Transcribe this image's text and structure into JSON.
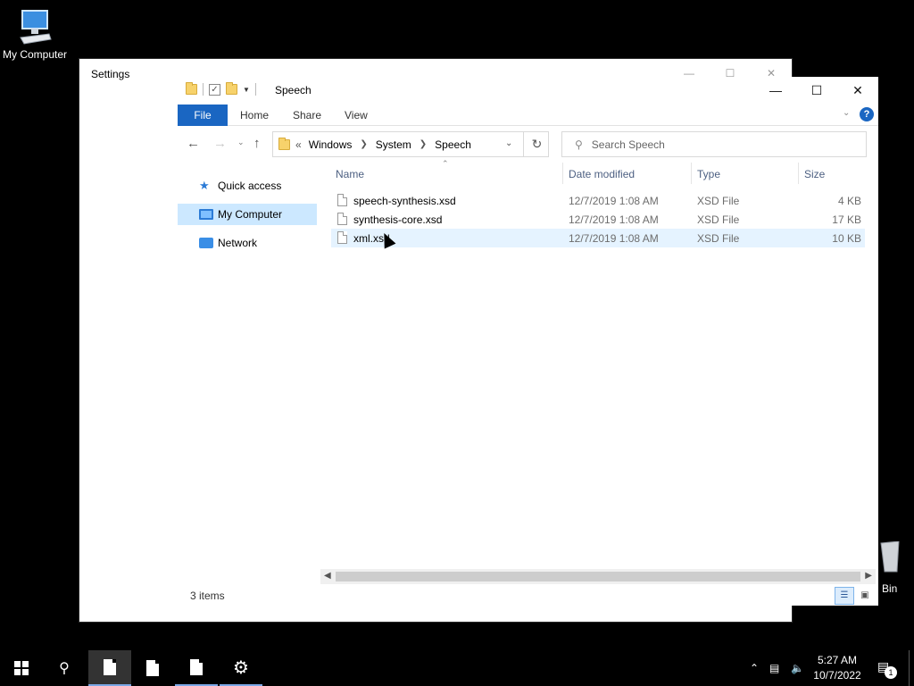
{
  "desktop": {
    "my_computer_label": "My Computer",
    "recycle_bin_label_visible": "Bin"
  },
  "settings_window": {
    "title": "Settings"
  },
  "explorer": {
    "title": "Speech",
    "ribbon_tabs": [
      "File",
      "Home",
      "Share",
      "View"
    ],
    "help_glyph": "?",
    "address": {
      "breadcrumb_prefix": "«",
      "crumbs": [
        "Windows",
        "System",
        "Speech"
      ]
    },
    "search": {
      "placeholder": "Search Speech"
    },
    "nav_pane": {
      "items": [
        {
          "label": "Quick access",
          "icon": "star-icon"
        },
        {
          "label": "My Computer",
          "icon": "computer-icon"
        },
        {
          "label": "Network",
          "icon": "network-icon"
        }
      ]
    },
    "columns": {
      "name": "Name",
      "date": "Date modified",
      "type": "Type",
      "size": "Size"
    },
    "files": [
      {
        "name": "speech-synthesis.xsd",
        "date": "12/7/2019 1:08 AM",
        "type": "XSD File",
        "size": "4 KB"
      },
      {
        "name": "synthesis-core.xsd",
        "date": "12/7/2019 1:08 AM",
        "type": "XSD File",
        "size": "17 KB"
      },
      {
        "name": "xml.xsd",
        "date": "12/7/2019 1:08 AM",
        "type": "XSD File",
        "size": "10 KB"
      }
    ],
    "status": {
      "item_count": "3 items"
    }
  },
  "taskbar": {
    "clock_time": "5:27 AM",
    "clock_date": "10/7/2022",
    "notification_count": "1"
  },
  "colors": {
    "accent": "#1a66c2",
    "selection": "#cce8ff",
    "row_selected": "#e5f3ff"
  }
}
